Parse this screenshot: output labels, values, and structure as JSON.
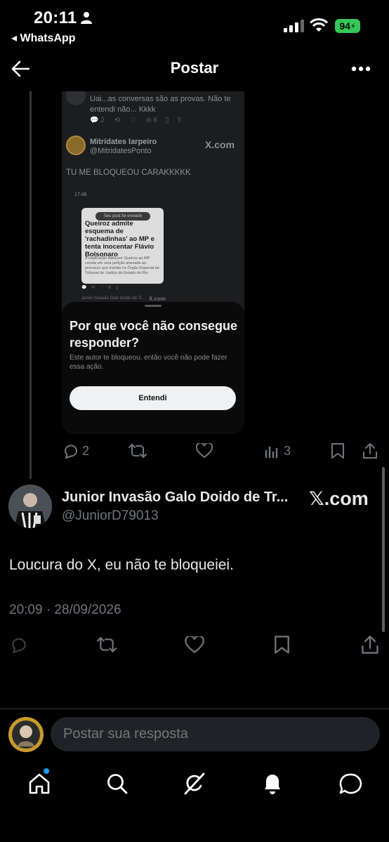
{
  "status_bar": {
    "time": "20:11",
    "back_app": "◂ WhatsApp",
    "battery": "94"
  },
  "header": {
    "title": "Postar"
  },
  "embedded_screenshot": {
    "reply_text": "Uai...as conversas são as provas. Não te entendi não... Kkkk",
    "reply_counts": {
      "replies": "2",
      "views": "6"
    },
    "quoted_author_name": "Mitrídates larpeiro",
    "quoted_author_handle": "@MitridatesPonto",
    "quoted_watermark": "X.com",
    "quoted_text": "TU ME BLOQUEOU CARAKKKKK",
    "mini_time": "17:46",
    "mini_pill": "Seu post foi enviado",
    "mini_headline": "Queiroz admite esquema de 'rachadinhas' ao MP e tenta inocentar Flávio Bolsonaro",
    "mini_body": "A explicação dada por Queiroz ao MP consta em uma petição anexada ao processo que tramita no Órgão Especial do Tribunal de Justiça do Estado do Rio",
    "mini_author": "Junior Invasão Galo Doido de Tr...",
    "mini_watermark": "X.com",
    "sheet_title": "Por que você não consegue responder?",
    "sheet_subtitle": "Este autor te bloqueou, então você não pode fazer essa ação.",
    "sheet_button": "Entendi"
  },
  "parent_actions": {
    "reply_count": "2",
    "views_count": "3"
  },
  "tweet": {
    "author_name": "Junior Invasão Galo Doido de Tr...",
    "author_handle": "@JuniorD79013",
    "watermark": "𝕏.com",
    "text": "Loucura do X, eu não te bloqueiei.",
    "timestamp": "20:09 · 28/09/2026"
  },
  "reply_box": {
    "placeholder": "Postar sua resposta"
  },
  "bottom_nav": {
    "items": [
      "home-icon",
      "search-icon",
      "grok-icon",
      "notifications-icon",
      "messages-icon"
    ]
  },
  "colors": {
    "accent": "#1d9bf0",
    "battery": "#34c759",
    "muted": "#71767b"
  }
}
